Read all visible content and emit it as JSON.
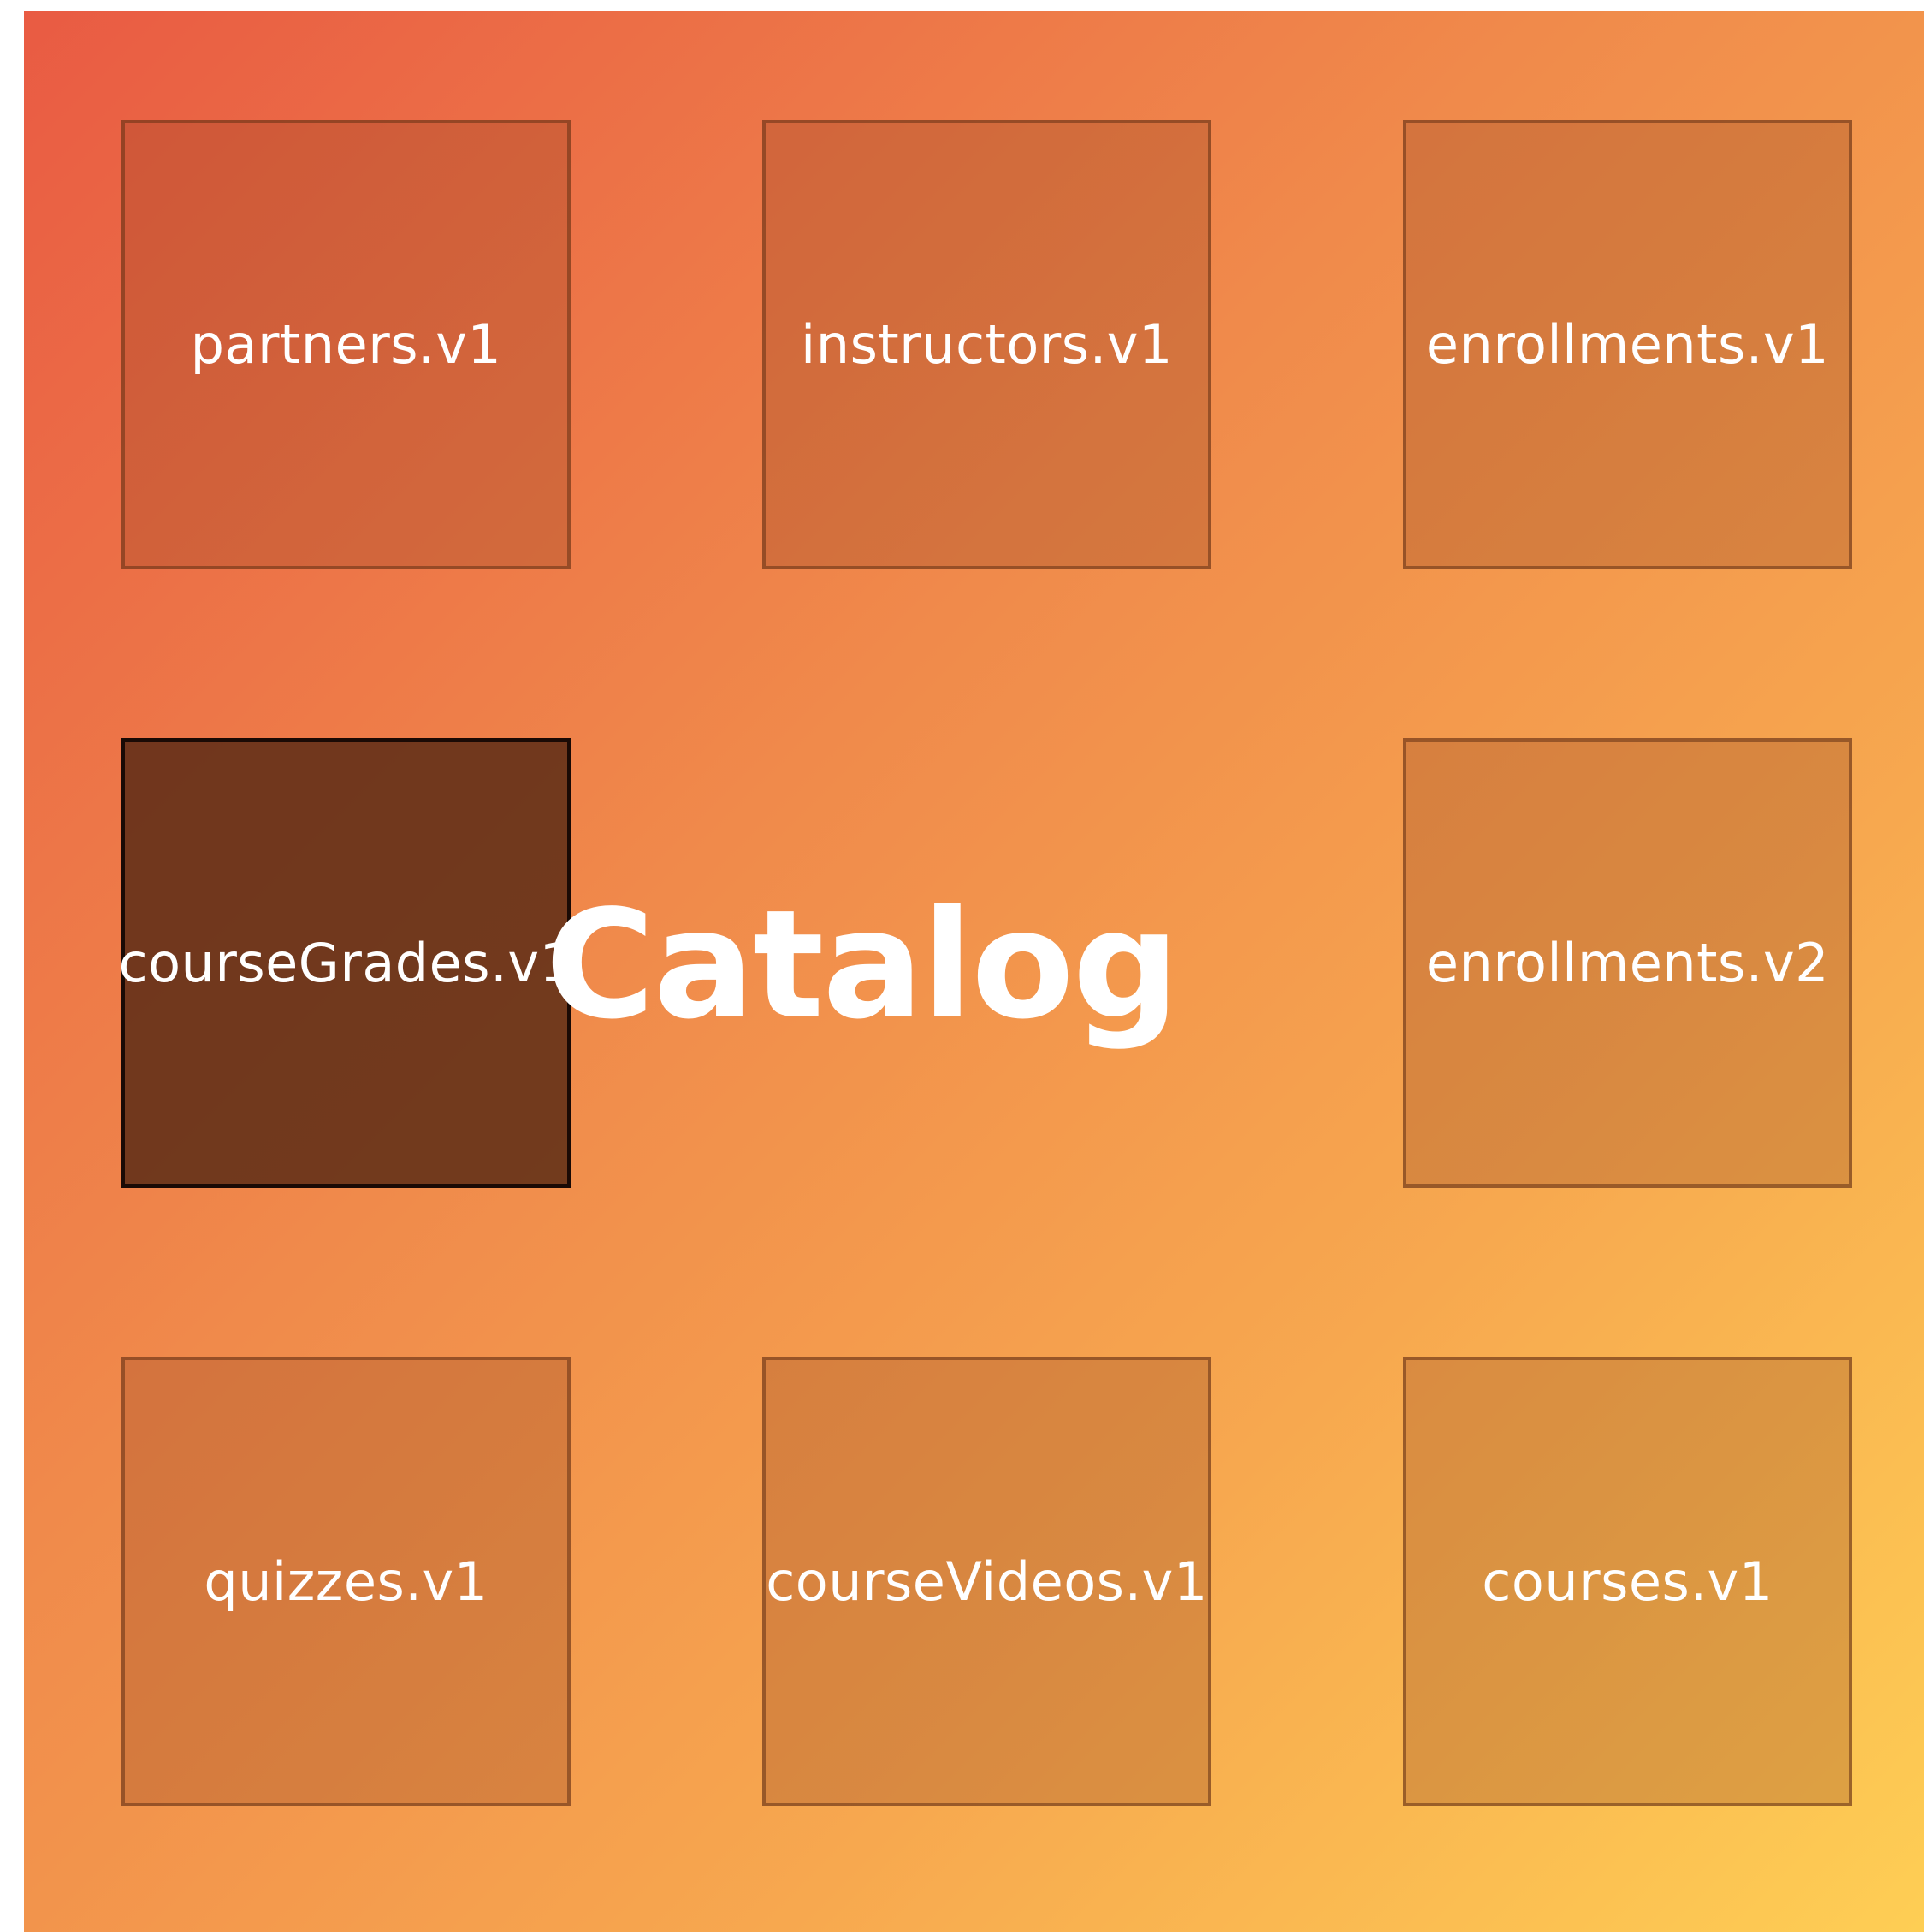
{
  "title": "Catalog",
  "tiles": [
    {
      "label": "partners.v1"
    },
    {
      "label": "instructors.v1"
    },
    {
      "label": "enrollments.v1"
    },
    {
      "label": "courseGrades.v1",
      "selected": true
    },
    {
      "label": "enrollments.v2"
    },
    {
      "label": "quizzes.v1"
    },
    {
      "label": "courseVideos.v1"
    },
    {
      "label": "courses.v1"
    }
  ]
}
